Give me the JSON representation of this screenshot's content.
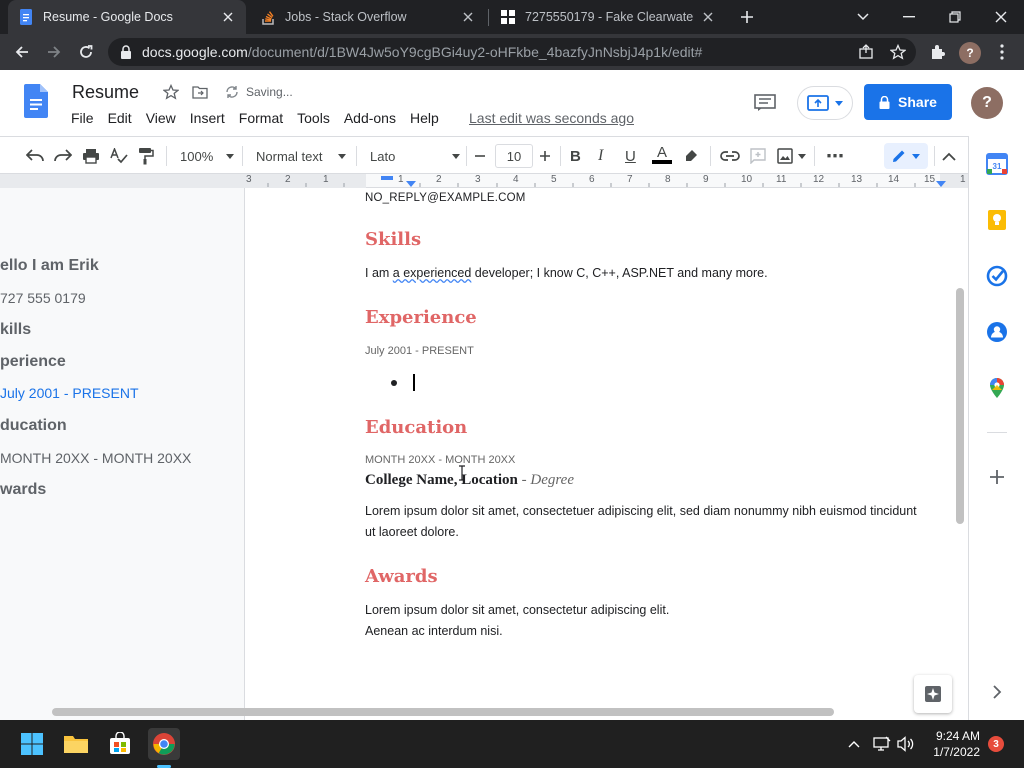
{
  "browser": {
    "tabs": [
      {
        "title": "Resume - Google Docs",
        "active": true
      },
      {
        "title": "Jobs - Stack Overflow",
        "active": false
      },
      {
        "title": "7275550179 - Fake Clearwater Ph",
        "active": false
      }
    ],
    "url_host": "docs.google.com",
    "url_path": "/document/d/1BW4Jw5oY9cgBGi4uy2-oHFkbe_4bazfyJnNsbjJ4p1k/edit#",
    "profile_initial": "?"
  },
  "docs": {
    "title": "Resume",
    "saving_status": "Saving...",
    "menu": [
      "File",
      "Edit",
      "View",
      "Insert",
      "Format",
      "Tools",
      "Add-ons",
      "Help"
    ],
    "last_edit": "Last edit was seconds ago",
    "share_label": "Share",
    "avatar_initial": "?"
  },
  "toolbar": {
    "zoom": "100%",
    "style": "Normal text",
    "font": "Lato",
    "font_size": "10",
    "bold": "B",
    "italic": "I",
    "underline": "U",
    "text_color": "A",
    "more": "⋯"
  },
  "ruler": {
    "ticks": [
      "3",
      "2",
      "1",
      "1",
      "2",
      "3",
      "4",
      "5",
      "6",
      "7",
      "8",
      "9",
      "10",
      "11",
      "12",
      "13",
      "14",
      "15",
      "1"
    ]
  },
  "outline": [
    {
      "text": "ello I am Erik",
      "level": "h1"
    },
    {
      "text": "727 555 0179",
      "level": "h2"
    },
    {
      "text": "kills",
      "level": "h1"
    },
    {
      "text": "perience",
      "level": "h1"
    },
    {
      "text": "July 2001 - PRESENT",
      "level": "h2",
      "active": true
    },
    {
      "text": "ducation",
      "level": "h1"
    },
    {
      "text": "MONTH 20XX - MONTH 20XX",
      "level": "h2"
    },
    {
      "text": "wards",
      "level": "h1"
    }
  ],
  "document": {
    "email": "NO_REPLY@EXAMPLE.COM",
    "skills_heading": "Skills",
    "skills_pre": "I am ",
    "skills_error": "a experienced",
    "skills_post": " developer; I know C, C++, ASP.NET and many more.",
    "experience_heading": "Experience",
    "experience_date": "July 2001 - PRESENT",
    "education_heading": "Education",
    "education_date": "MONTH  20XX - MONTH 20XX",
    "education_school": "College Name, Location",
    "education_dash": " - ",
    "education_degree": "Degree",
    "education_body_1": "Lorem ipsum dolor sit amet, consectetuer adipiscing elit, sed diam nonummy nibh euismod tincidunt",
    "education_body_2": "ut laoreet dolore.",
    "awards_heading": "Awards",
    "awards_line_1": "Lorem ipsum dolor sit amet, consectetur adipiscing elit.",
    "awards_line_2": "Aenean ac interdum nisi."
  },
  "taskbar": {
    "time": "9:24 AM",
    "date": "1/7/2022",
    "notifications": "3"
  },
  "colors": {
    "accent": "#1a73e8",
    "heading": "#e06666",
    "docs_blue": "#4285f4"
  }
}
